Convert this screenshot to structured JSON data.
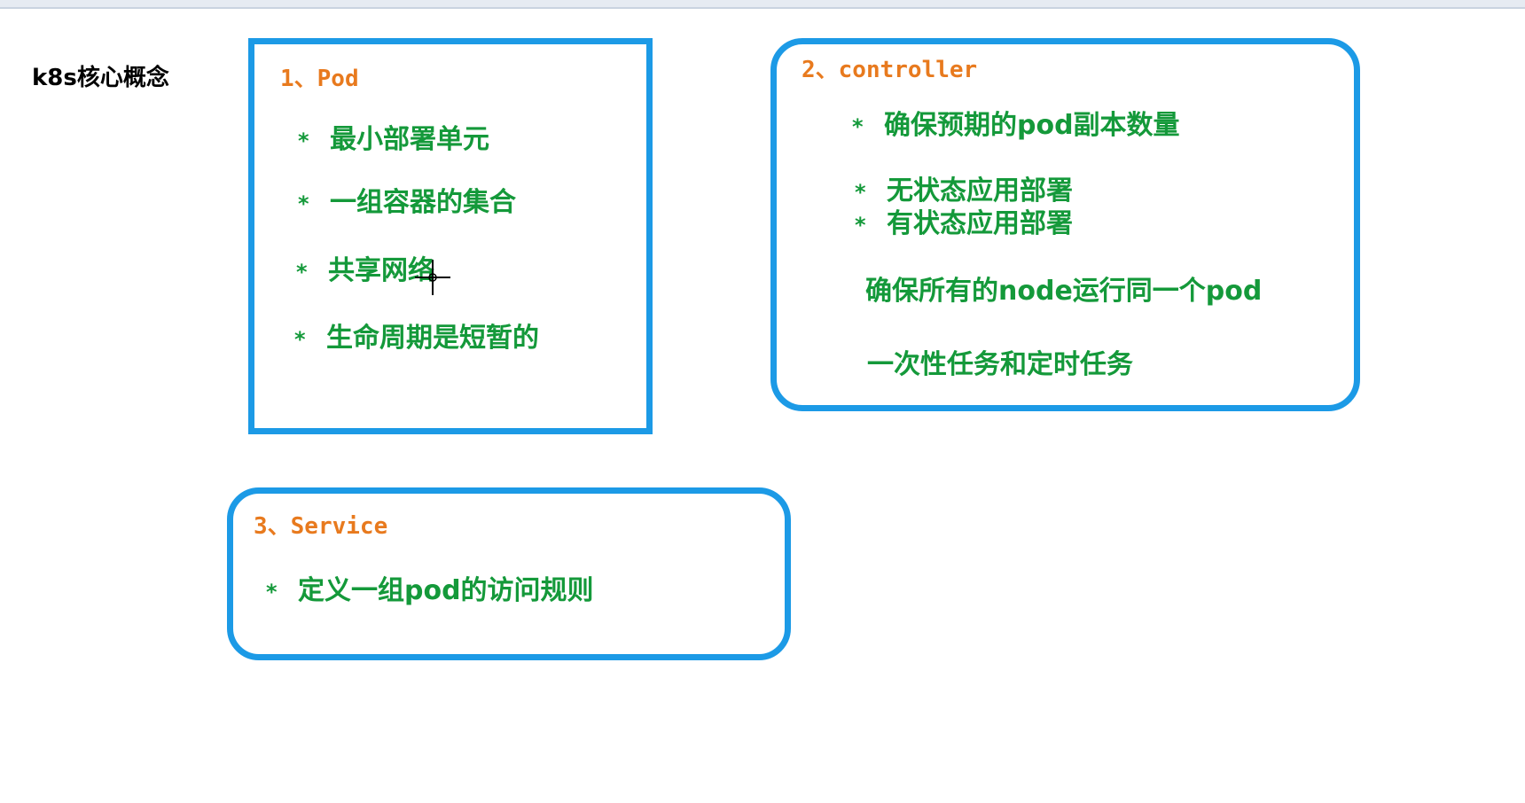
{
  "title": "k8s核心概念",
  "pod": {
    "heading": "1、Pod",
    "items": [
      "最小部署单元",
      "一组容器的集合",
      "共享网络",
      "生命周期是短暂的"
    ]
  },
  "controller": {
    "heading": "2、controller",
    "items": [
      "确保预期的pod副本数量",
      "无状态应用部署",
      "有状态应用部署"
    ],
    "lines": [
      "确保所有的node运行同一个pod",
      "一次性任务和定时任务"
    ]
  },
  "service": {
    "heading": "3、Service",
    "items": [
      "定义一组pod的访问规则"
    ]
  },
  "bullet": "*",
  "colors": {
    "box_border": "#1c9ae6",
    "heading": "#e87a1e",
    "item_text": "#14993a",
    "title": "#000000"
  },
  "icons": {
    "cursor": "crosshair-cursor-icon"
  }
}
